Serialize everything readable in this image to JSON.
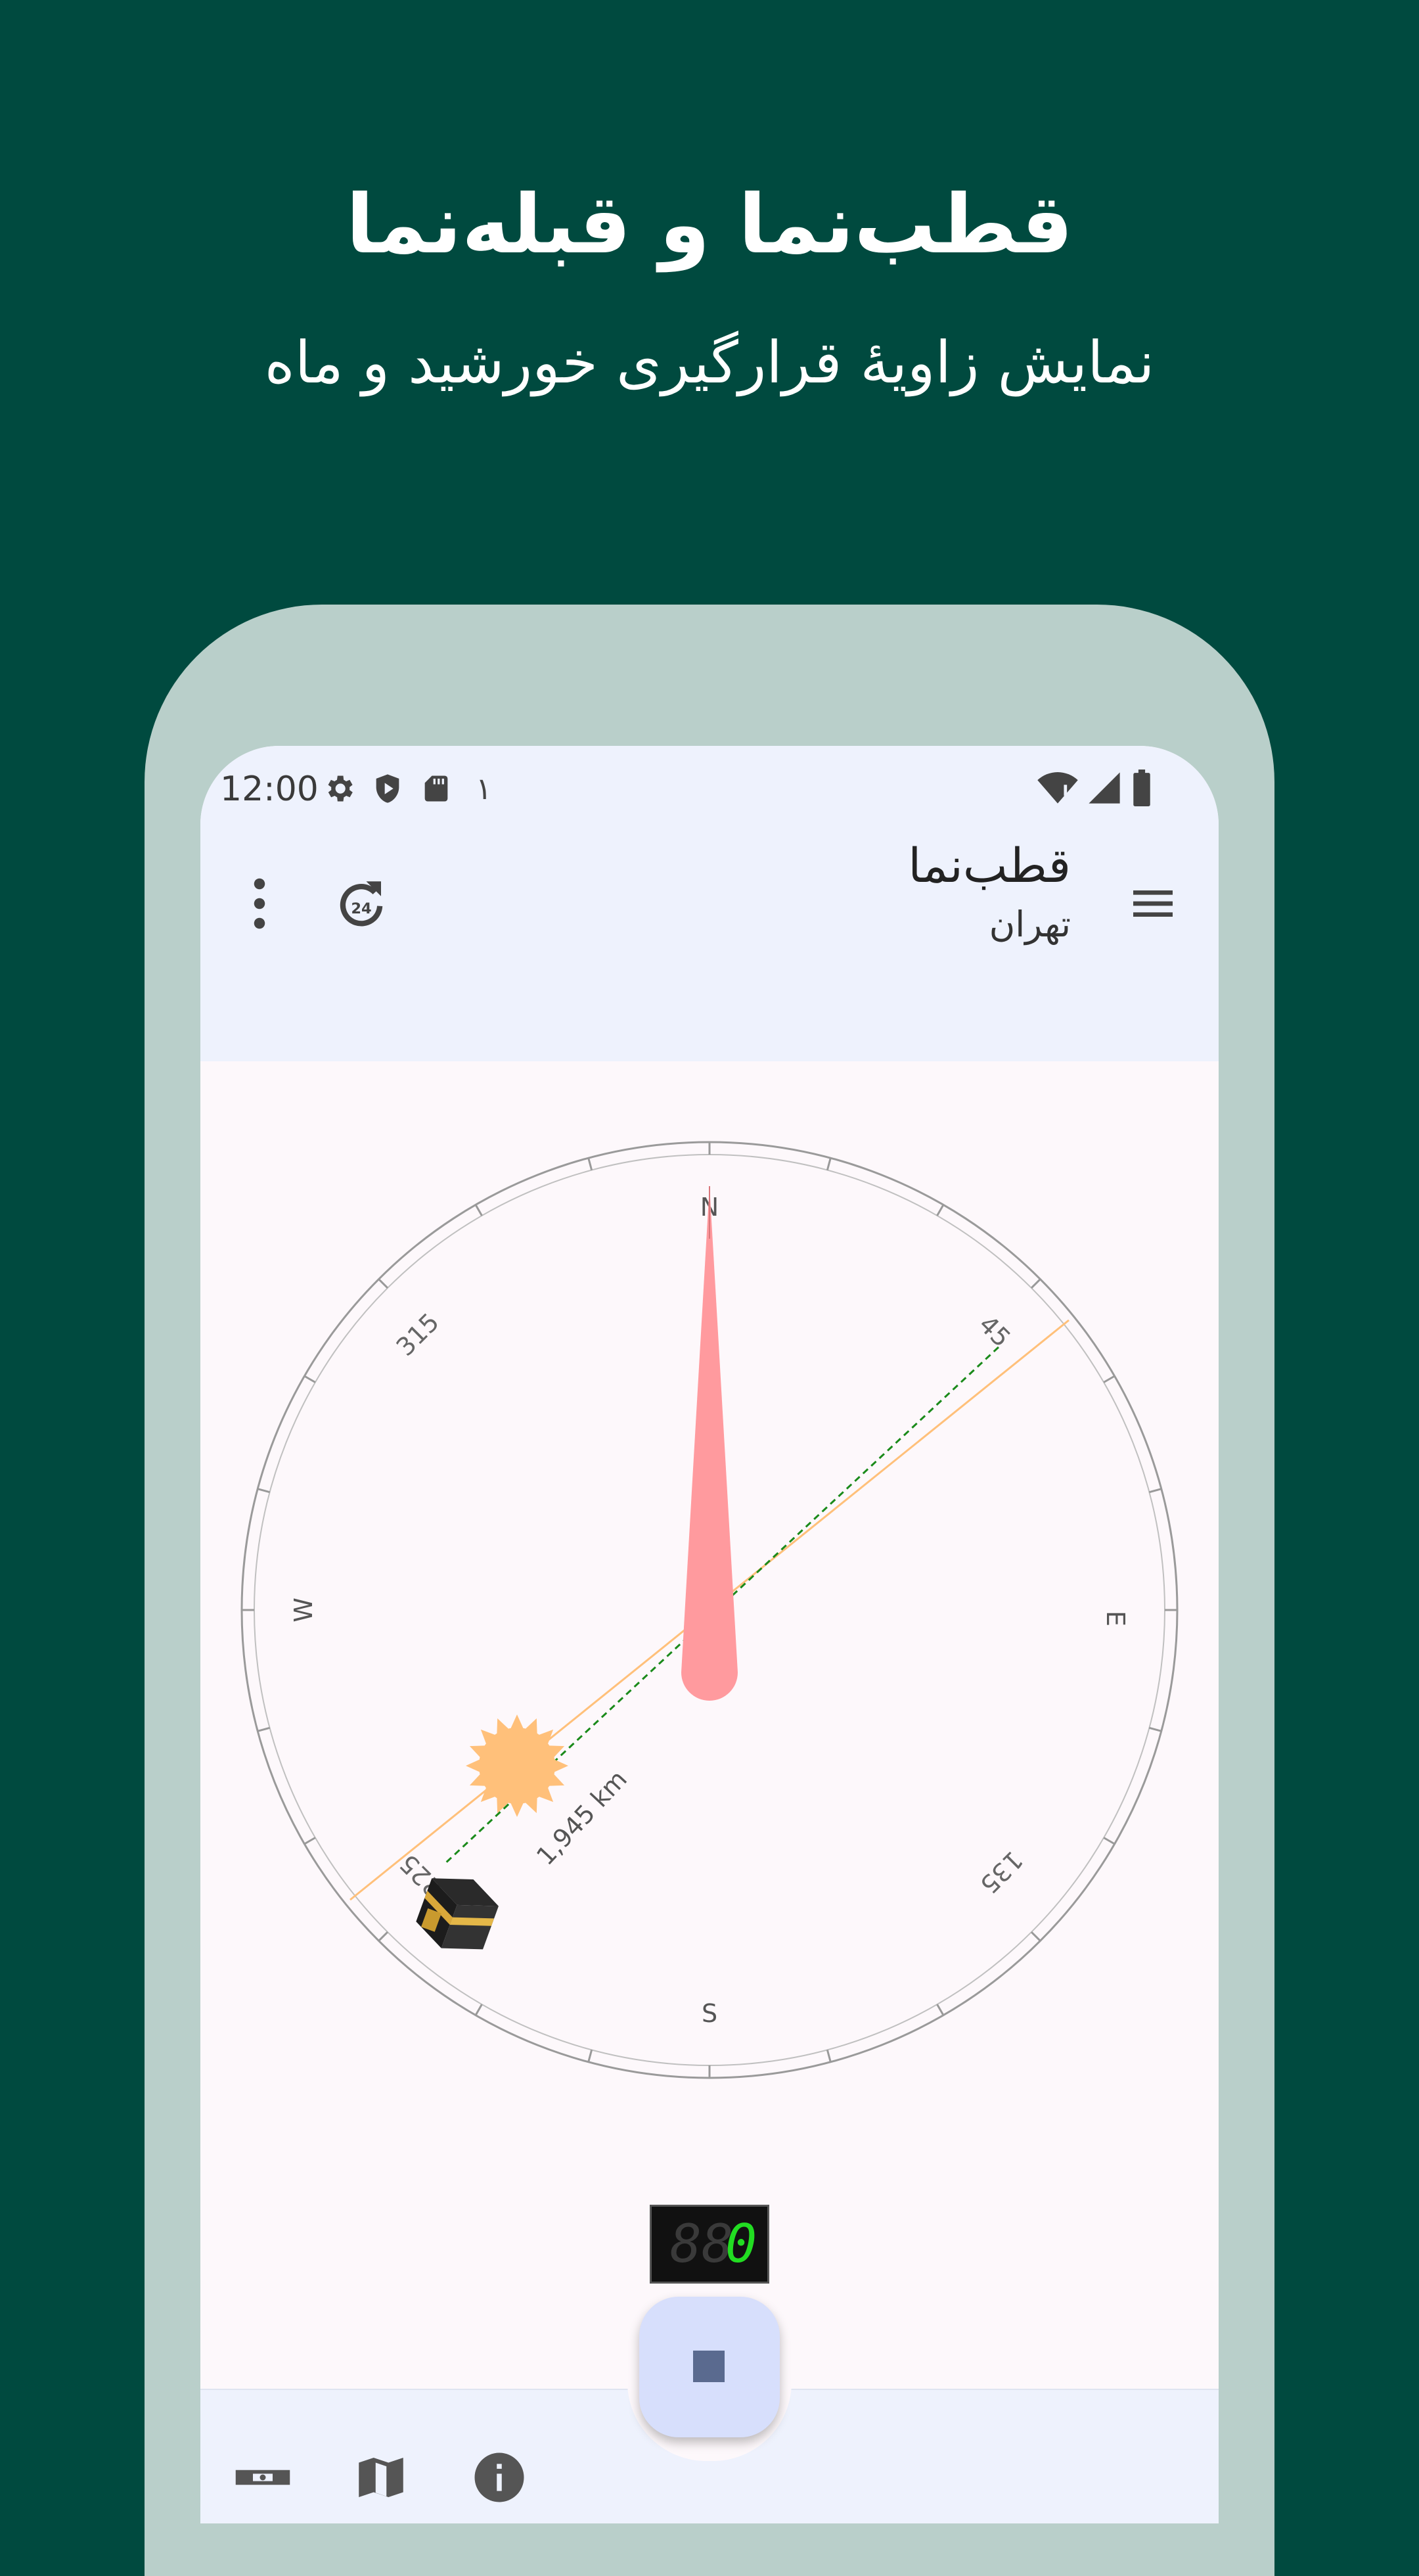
{
  "promo": {
    "headline": "قطب‌نما و قبله‌نما",
    "subline": "نمایش زاویهٔ قرارگیری خورشید و ماه"
  },
  "status_bar": {
    "time": "12:00",
    "notification_count": "۱",
    "icons_left": [
      "gear-icon",
      "shield-icon",
      "sd-card-icon"
    ],
    "icons_right": [
      "wifi-icon",
      "signal-icon",
      "battery-icon"
    ]
  },
  "app_bar": {
    "title": "قطب‌نما",
    "subtitle": "تهران",
    "icons": [
      "menu-icon",
      "refresh-24-icon",
      "more-vert-icon"
    ]
  },
  "compass": {
    "cardinals": {
      "north": "N",
      "east": "E",
      "south": "S",
      "west": "W"
    },
    "degree_labels": {
      "ne": "45",
      "se": "135",
      "sw": "225",
      "nw": "315"
    },
    "qibla_distance": "1,945 km",
    "qibla_bearing_deg": 237,
    "sun_bearing_deg": 236,
    "needle_bearing_deg": 0,
    "needle_color": "#ff9a9e",
    "sun_color": "#ffc07a",
    "qibla_line_color": "#1a8a1a"
  },
  "counter": {
    "dim_digits": "88",
    "active_digit": "0",
    "active_color": "#22dd22"
  },
  "fab": {
    "icon": "stop-icon"
  },
  "bottom_bar": {
    "icons": [
      "level-icon",
      "map-icon",
      "info-icon"
    ]
  },
  "colors": {
    "background": "#004a3f",
    "device_frame": "#b9cfca",
    "bar_background": "#eef2fd",
    "fab_background": "#d7dffc"
  }
}
